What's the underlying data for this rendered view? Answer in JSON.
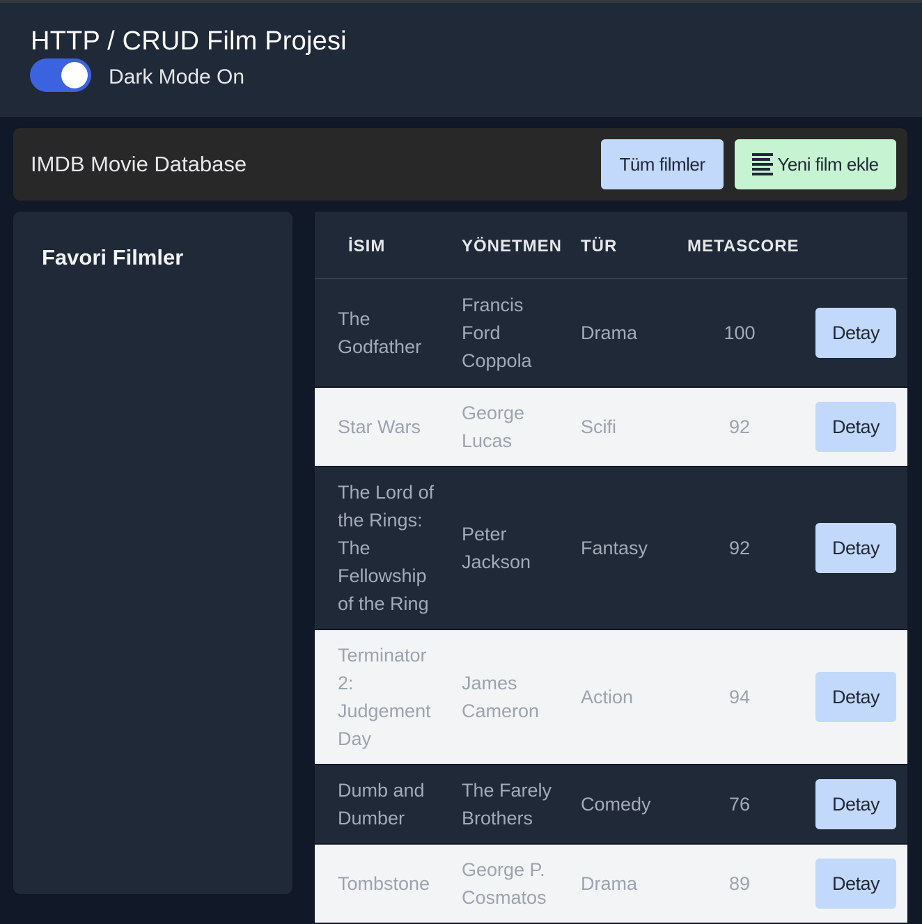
{
  "header": {
    "title": "HTTP / CRUD Film Projesi",
    "dark_mode_label": "Dark Mode On",
    "dark_mode_on": true
  },
  "navbar": {
    "title": "IMDB Movie Database",
    "all_movies_label": "Tüm filmler",
    "add_movie_label": "Yeni film ekle"
  },
  "sidebar": {
    "title": "Favori Filmler"
  },
  "table": {
    "headers": {
      "name": "İSIM",
      "director": "YÖNETMEN",
      "genre": "TÜR",
      "metascore": "METASCORE"
    },
    "rows": [
      {
        "name": "The Godfather",
        "director": "Francis Ford Coppola",
        "genre": "Drama",
        "metascore": "100",
        "action": "Detay"
      },
      {
        "name": "Star Wars",
        "director": "George Lucas",
        "genre": "Scifi",
        "metascore": "92",
        "action": "Detay"
      },
      {
        "name": "The Lord of the Rings: The Fellowship of the Ring",
        "director": "Peter Jackson",
        "genre": "Fantasy",
        "metascore": "92",
        "action": "Detay"
      },
      {
        "name": "Terminator 2: Judgement Day",
        "director": "James Cameron",
        "genre": "Action",
        "metascore": "94",
        "action": "Detay"
      },
      {
        "name": "Dumb and Dumber",
        "director": "The Farely Brothers",
        "genre": "Comedy",
        "metascore": "76",
        "action": "Detay"
      },
      {
        "name": "Tombstone",
        "director": "George P. Cosmatos",
        "genre": "Drama",
        "metascore": "89",
        "action": "Detay"
      }
    ]
  },
  "colors": {
    "page_bg": "#111827",
    "panel_bg": "#1f2937",
    "toggle_accent": "#3b63e0",
    "primary_button": "#c3d9fb",
    "success_button": "#c6f3d2"
  },
  "icons": {
    "add_movie": "list-icon"
  }
}
